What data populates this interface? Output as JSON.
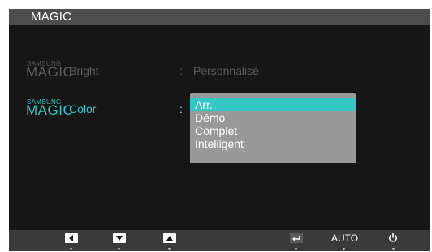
{
  "title": "MAGIC",
  "logo": {
    "brand": "SAMSUNG",
    "name": "MAGIC"
  },
  "menu": [
    {
      "label": "Bright",
      "separator": ":",
      "value": "Personnalisé",
      "state": "dimmed"
    },
    {
      "label": "Color",
      "separator": ":",
      "state": "active"
    }
  ],
  "dropdown": {
    "options": [
      "Arr.",
      "Démo",
      "Complet",
      "Intelligent"
    ],
    "selected": "Arr."
  },
  "bottom_bar": {
    "buttons": [
      {
        "icon": "left-arrow-icon"
      },
      {
        "icon": "down-arrow-icon"
      },
      {
        "icon": "up-arrow-icon"
      },
      {
        "icon": "enter-icon"
      },
      {
        "label": "AUTO"
      },
      {
        "icon": "power-icon"
      }
    ],
    "tick_glyph": "▼"
  },
  "colors": {
    "accent": "#35c6c6",
    "background": "#161616",
    "titlebar": "#4d4d4d",
    "dropdown": "#999999",
    "dim_text": "#5b5b5b"
  }
}
